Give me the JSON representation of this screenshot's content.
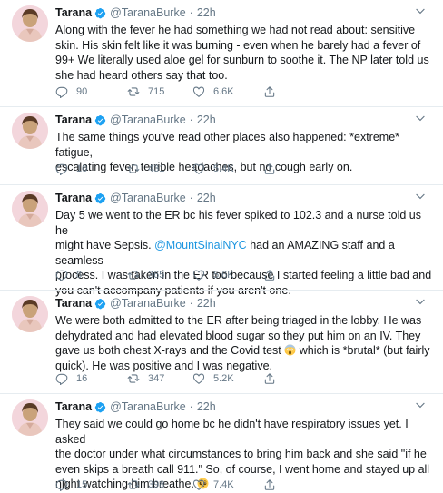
{
  "colors": {
    "accent": "#1b95e0",
    "verified": "#1da1f2",
    "muted": "#657786",
    "text": "#14171a",
    "divider": "#e6ecf0"
  },
  "tweets": [
    {
      "author_name": "Tarana",
      "handle": "@TaranaBurke",
      "separator": "·",
      "time": "22h",
      "lines": [
        "Along with the fever he had something we had not read about: sensitive",
        "skin. His skin felt like it was burning - even when he barely had a fever of",
        "99+ We literally used aloe gel for sunburn to soothe it. The NP later told us",
        "she had heard others say that too."
      ],
      "replies": "90",
      "retweets": "715",
      "likes": "6.6K"
    },
    {
      "author_name": "Tarana",
      "handle": "@TaranaBurke",
      "separator": "·",
      "time": "22h",
      "lines": [
        "The same things you've read other places also happened: *extreme* fatigue,",
        "escalating fever, terrible headaches, but no cough early on."
      ],
      "replies": "10",
      "retweets": "431",
      "likes": "5.4K"
    },
    {
      "author_name": "Tarana",
      "handle": "@TaranaBurke",
      "separator": "·",
      "time": "22h",
      "lines": [
        "Day 5 we went to the ER bc his fever spiked to 102.3 and a nurse told us he",
        "might have Sepsis.",
        "I was taken in the ER too because I started feeling a little bad and",
        "you can't accompany patients if you aren't one."
      ],
      "mention": "@MountSinaiNYC",
      "mention_tail": "had an AMAZING staff and a seamless",
      "mention_line_end": "process.",
      "replies": "8",
      "retweets": "365",
      "likes": "5.6K"
    },
    {
      "author_name": "Tarana",
      "handle": "@TaranaBurke",
      "separator": "·",
      "time": "22h",
      "lines": [
        "We were both admitted to the ER after being triaged in the lobby. He was",
        "dehydrated and had elevated blood sugar so they put him on an IV. They",
        "gave us both chest X-rays and the Covid test",
        "which is *brutal* (but fairly",
        "quick). He was positive and I was negative."
      ],
      "emoji_name": "face-screaming-in-fear-emoji",
      "replies": "16",
      "retweets": "347",
      "likes": "5.2K"
    },
    {
      "author_name": "Tarana",
      "handle": "@TaranaBurke",
      "separator": "·",
      "time": "22h",
      "lines": [
        "They said we could go home bc he didn't have respiratory issues yet. I asked",
        "the doctor under what circumstances to bring him back and she said \"if he",
        "even skips a breath call 911.\" So, of course, I went home and stayed up all",
        "night watching him breathe."
      ],
      "emoji_name": "pleading-face-emoji",
      "replies": "15",
      "retweets": "398",
      "likes": "7.4K"
    }
  ],
  "icons": {
    "reply": "reply-icon",
    "retweet": "retweet-icon",
    "like": "like-icon",
    "share": "share-icon",
    "more": "chevron-down-icon",
    "verified": "verified-badge-icon"
  }
}
